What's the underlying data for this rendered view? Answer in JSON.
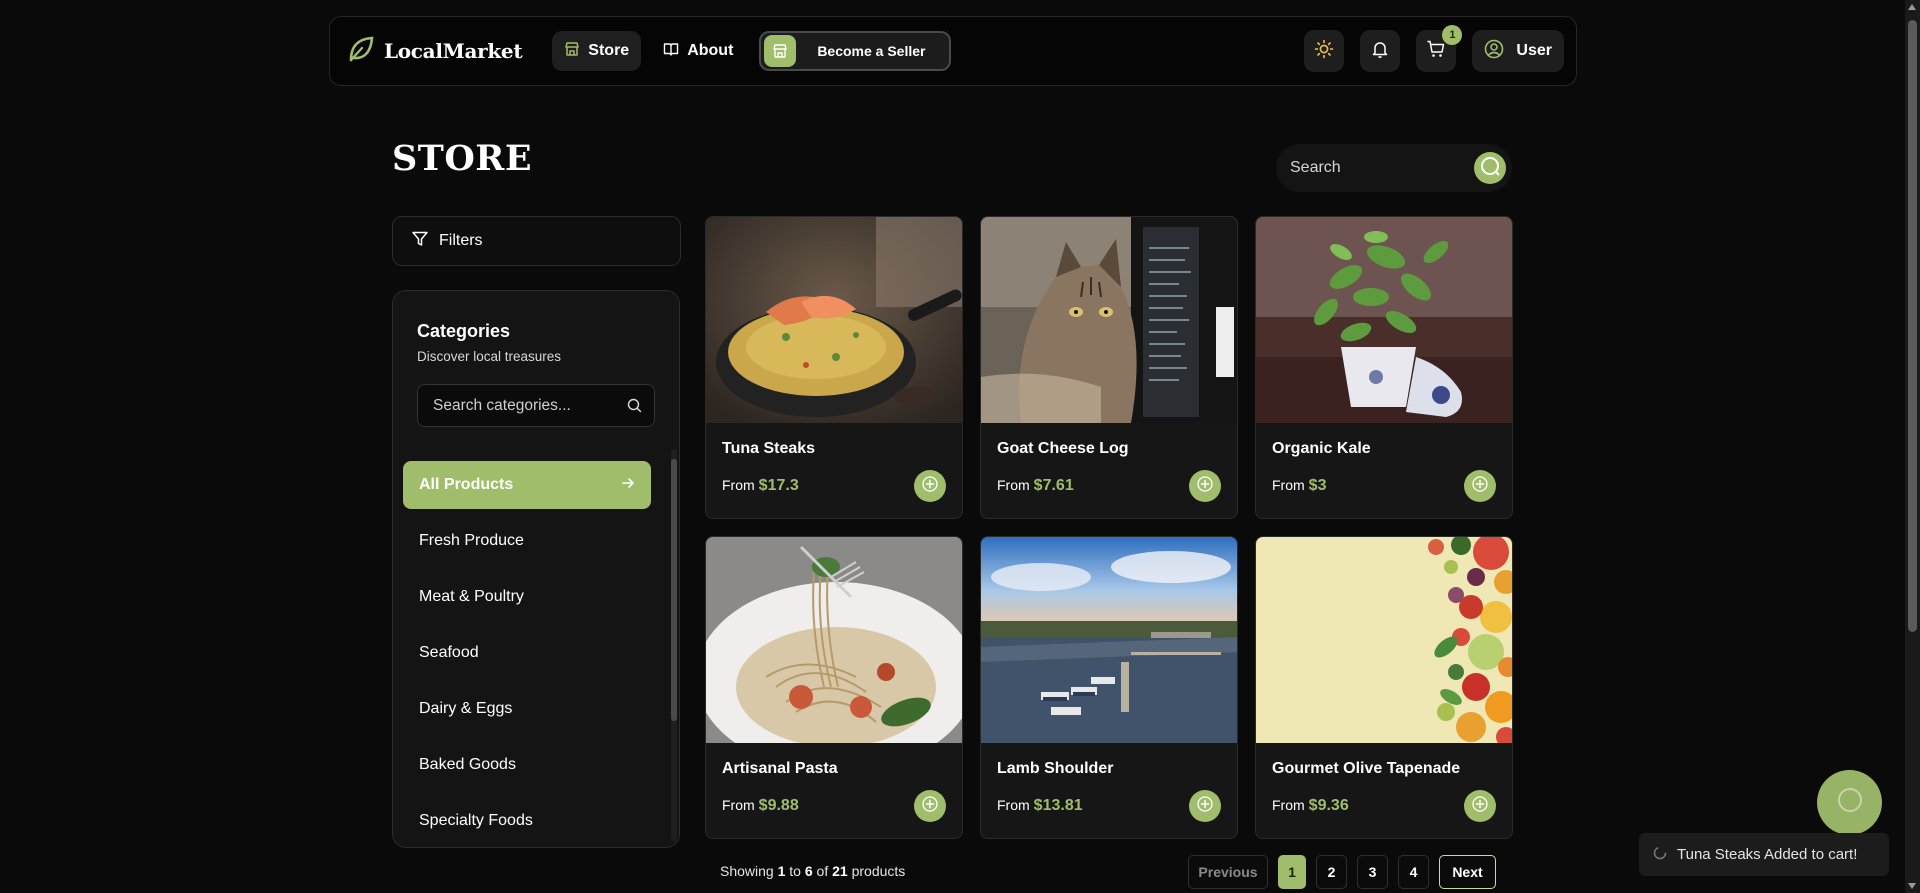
{
  "brand": {
    "name": "LocalMarket",
    "accent": "#9fbd6a"
  },
  "nav": {
    "store_label": "Store",
    "about_label": "About",
    "seller_label": "Become a Seller",
    "cart_count": "1",
    "user_label": "User"
  },
  "store": {
    "title": "STORE",
    "search_placeholder": "Search"
  },
  "filters": {
    "label": "Filters"
  },
  "categories": {
    "title": "Categories",
    "subtitle": "Discover local treasures",
    "search_placeholder": "Search categories...",
    "items": [
      {
        "label": "All Products"
      },
      {
        "label": "Fresh Produce"
      },
      {
        "label": "Meat & Poultry"
      },
      {
        "label": "Seafood"
      },
      {
        "label": "Dairy & Eggs"
      },
      {
        "label": "Baked Goods"
      },
      {
        "label": "Specialty Foods"
      }
    ]
  },
  "products": [
    {
      "name": "Tuna Steaks",
      "from": "From",
      "price": "$17.3"
    },
    {
      "name": "Goat Cheese Log",
      "from": "From",
      "price": "$7.61"
    },
    {
      "name": "Organic Kale",
      "from": "From",
      "price": "$3"
    },
    {
      "name": "Artisanal Pasta",
      "from": "From",
      "price": "$9.88"
    },
    {
      "name": "Lamb Shoulder",
      "from": "From",
      "price": "$13.81"
    },
    {
      "name": "Gourmet Olive Tapenade",
      "from": "From",
      "price": "$9.36"
    }
  ],
  "pagination": {
    "showing_prefix": "Showing",
    "start": "1",
    "to": "to",
    "end": "6",
    "of": "of",
    "total": "21",
    "suffix": "products",
    "previous": "Previous",
    "pages": [
      "1",
      "2",
      "3",
      "4"
    ],
    "next": "Next"
  },
  "toast": {
    "message": "Tuna Steaks Added to cart!"
  }
}
